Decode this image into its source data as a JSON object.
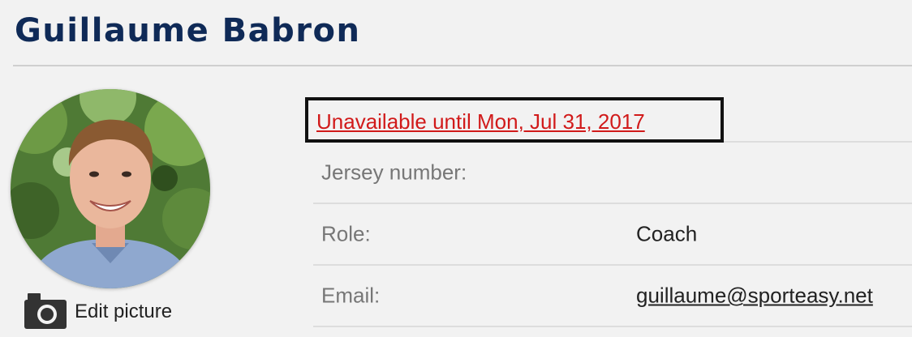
{
  "profile": {
    "name": "Guillaume Babron",
    "edit_picture_label": "Edit picture",
    "status_link": "Unavailable until Mon, Jul 31, 2017",
    "rows": [
      {
        "label": "Jersey number:",
        "value": ""
      },
      {
        "label": "Role:",
        "value": "Coach"
      },
      {
        "label": "Email:",
        "value": "guillaume@sporteasy.net"
      }
    ]
  },
  "colors": {
    "title": "#0f2a57",
    "status": "#d11a1a",
    "label": "#777777",
    "background": "#f2f2f2"
  },
  "icons": {
    "edit_picture": "camera-icon"
  }
}
